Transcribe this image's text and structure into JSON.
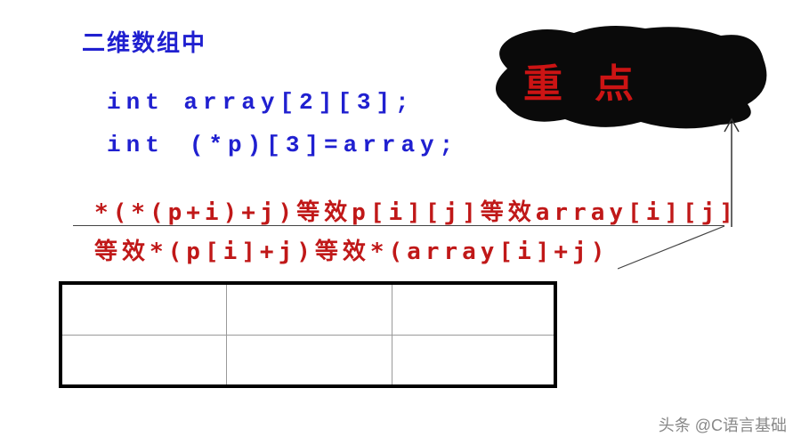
{
  "title": "二维数组中",
  "code": {
    "line1": "int array[2][3];",
    "line2a": "int",
    "line2b": "(*p)[3]=array;"
  },
  "equiv": {
    "line1": "*(*(p+i)+j)等效p[i][j]等效array[i][j]",
    "line2": "等效*(p[i]+j)等效*(array[i]+j)"
  },
  "blob_label": "重点",
  "table": {
    "rows": 2,
    "cols": 3
  },
  "watermark": "头条 @C语言基础",
  "colors": {
    "blue": "#2020d0",
    "red": "#c01818",
    "blob_red": "#cc1414"
  }
}
